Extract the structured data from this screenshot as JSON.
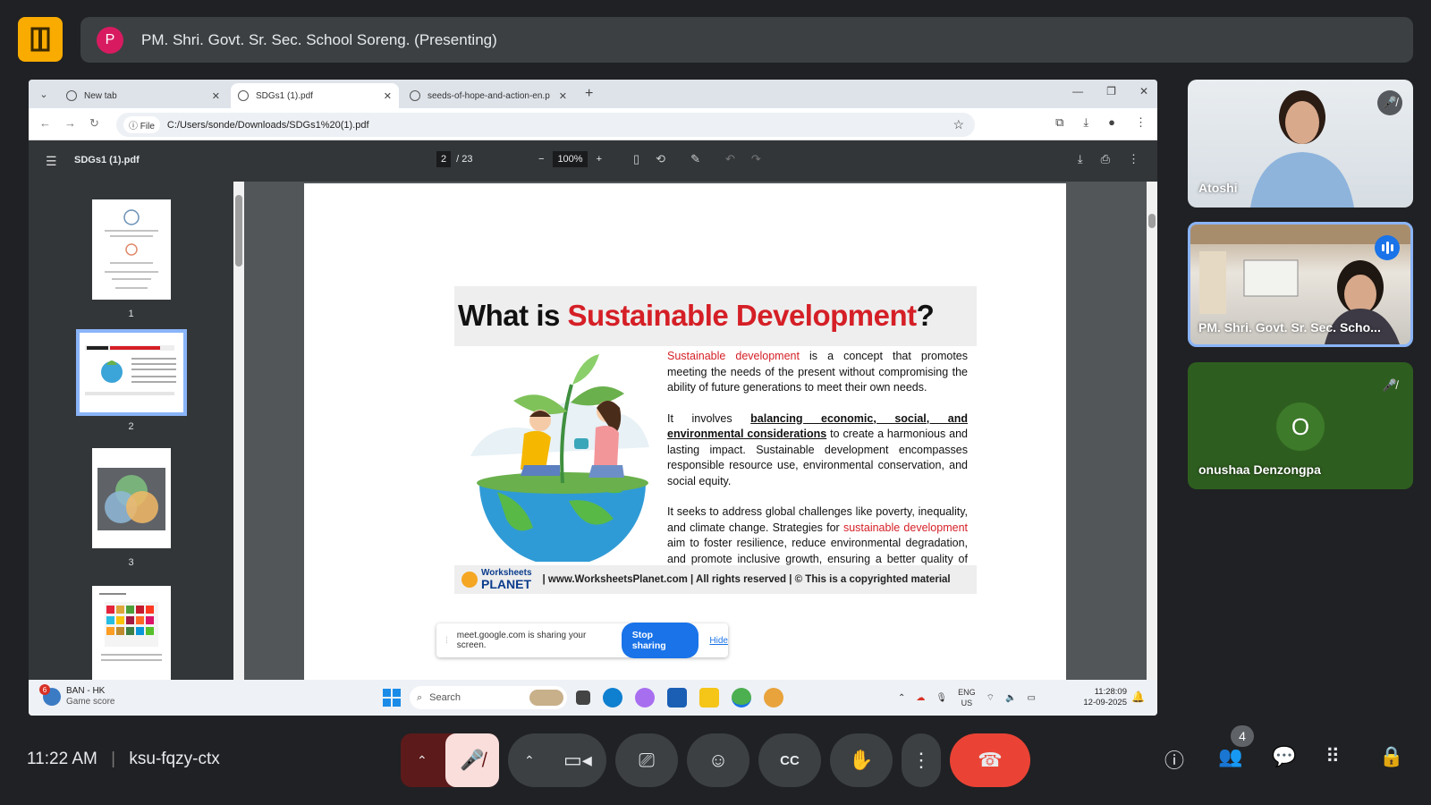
{
  "meeting": {
    "presenter_initial": "P",
    "presenter_text": "PM. Shri. Govt. Sr. Sec. School Soreng. (Presenting)",
    "time": "11:22 AM",
    "code": "ksu-fqzy-ctx",
    "people_count": "4"
  },
  "browser": {
    "tabs": [
      {
        "label": "New tab"
      },
      {
        "label": "SDGs1 (1).pdf"
      },
      {
        "label": "seeds-of-hope-and-action-en.p"
      }
    ],
    "file_chip": "File",
    "url": "C:/Users/sonde/Downloads/SDGs1%20(1).pdf"
  },
  "pdf": {
    "title": "SDGs1 (1).pdf",
    "current_page": "2",
    "total_pages": "/ 23",
    "zoom": "100%",
    "thumbnails": [
      "1",
      "2",
      "3"
    ]
  },
  "slide": {
    "title_prefix": "What is ",
    "title_red": "Sustainable Development",
    "title_suffix": "?",
    "p1_red": "Sustainable development",
    "p1_rest": " is a concept that promotes meeting the needs of the present without compromising the ability of future generations to meet their own needs.",
    "p2_start": "It involves ",
    "p2_underline": "balancing economic, social, and environmental considerations",
    "p2_rest": " to create a harmonious and lasting impact. Sustainable development encompasses responsible resource use, environmental conservation, and social equity.",
    "p3_start": "It seeks to address global challenges like poverty, inequality, and climate change. Strategies for ",
    "p3_red": "sustainable development",
    "p3_rest": " aim to foster resilience, reduce environmental degradation, and promote inclusive growth, ensuring a better quality of life for current and future generations.",
    "logo_top": "Worksheets",
    "logo_bottom": "PLANET",
    "footer": "| www.WorksheetsPlanet.com | All rights reserved | © This is a copyrighted material"
  },
  "share_bar": {
    "message": "meet.google.com is sharing your screen.",
    "stop_label": "Stop sharing",
    "hide_label": "Hide"
  },
  "taskbar": {
    "weather_badge": "6",
    "weather_line1": "BAN - HK",
    "weather_line2": "Game score",
    "search_placeholder": "Search",
    "lang_line1": "ENG",
    "lang_line2": "US",
    "clock_time": "11:28:09",
    "clock_date": "12-09-2025"
  },
  "participants": [
    {
      "name": "Atoshi"
    },
    {
      "name": "PM. Shri. Govt. Sr. Sec. Scho..."
    },
    {
      "name": "onushaa Denzongpa",
      "initial": "O"
    }
  ],
  "colors": {
    "accent_red": "#d51f26",
    "meet_blue": "#1a73e8",
    "end_call": "#ea4335"
  }
}
